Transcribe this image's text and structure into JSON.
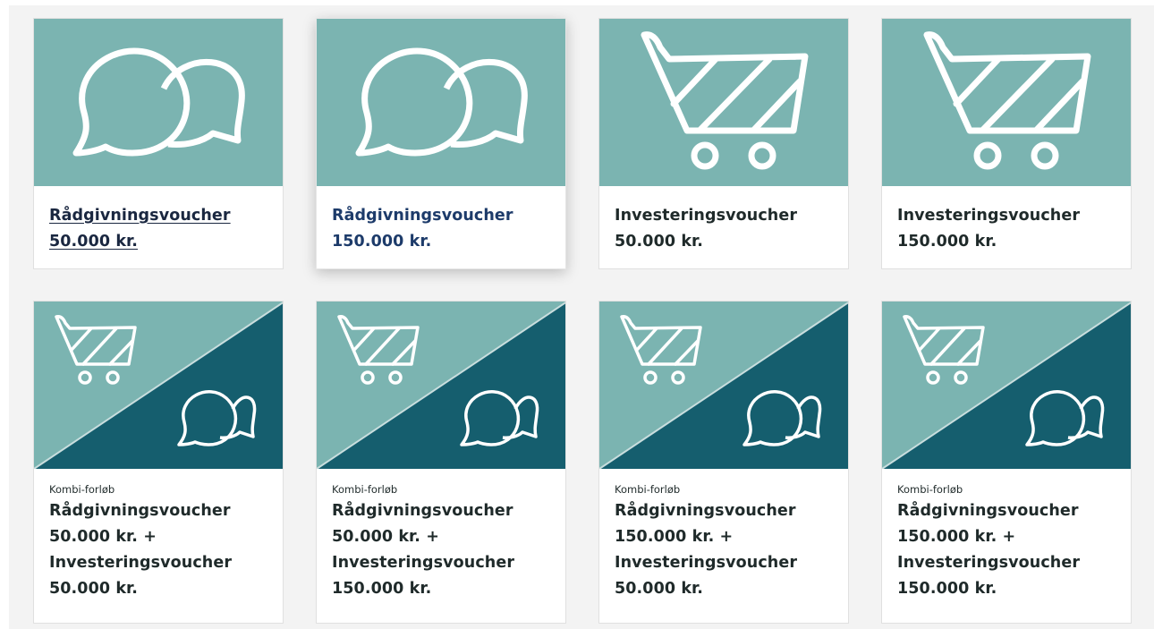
{
  "colors": {
    "light_teal": "#7bb4b1",
    "dark_teal": "#155e6e",
    "icon_stroke": "#ffffff",
    "text": "#1f2a2a",
    "link_text": "#1a2740"
  },
  "cards": [
    {
      "icon": "chat-bubbles-icon",
      "lines": [
        "Rådgivningsvoucher",
        "50.000 kr."
      ]
    },
    {
      "icon": "chat-bubbles-icon",
      "lines": [
        "Rådgivningsvoucher",
        "150.000 kr."
      ]
    },
    {
      "icon": "shopping-cart-icon",
      "lines": [
        "Investeringsvoucher",
        "50.000 kr."
      ]
    },
    {
      "icon": "shopping-cart-icon",
      "lines": [
        "Investeringsvoucher",
        "150.000 kr."
      ]
    },
    {
      "icon": "cart-and-chat-icon",
      "label": "Kombi-forløb",
      "lines": [
        "Rådgivningsvoucher",
        "50.000 kr. +",
        "Investeringsvoucher",
        "50.000 kr."
      ]
    },
    {
      "icon": "cart-and-chat-icon",
      "label": "Kombi-forløb",
      "lines": [
        "Rådgivningsvoucher",
        "50.000 kr. +",
        "Investeringsvoucher",
        "150.000 kr."
      ]
    },
    {
      "icon": "cart-and-chat-icon",
      "label": "Kombi-forløb",
      "lines": [
        "Rådgivningsvoucher",
        "150.000 kr. +",
        "Investeringsvoucher",
        "50.000 kr."
      ]
    },
    {
      "icon": "cart-and-chat-icon",
      "label": "Kombi-forløb",
      "lines": [
        "Rådgivningsvoucher",
        "150.000 kr. +",
        "Investeringsvoucher",
        "150.000 kr."
      ]
    }
  ]
}
